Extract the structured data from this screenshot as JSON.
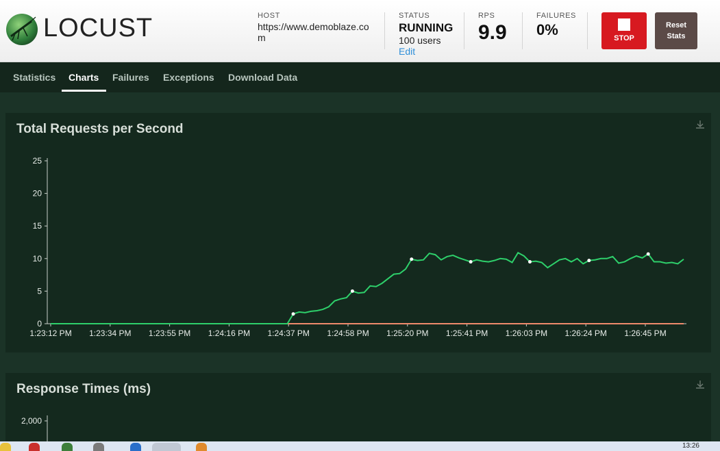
{
  "app": {
    "name": "LOCUST"
  },
  "header": {
    "host_label": "HOST",
    "host_value": "https://www.demoblaze.com",
    "status_label": "STATUS",
    "status_value": "RUNNING",
    "users_value": "100 users",
    "edit_label": "Edit",
    "rps_label": "RPS",
    "rps_value": "9.9",
    "failures_label": "FAILURES",
    "failures_value": "0%",
    "stop_label": "STOP",
    "reset_label_1": "Reset",
    "reset_label_2": "Stats"
  },
  "tabs": [
    {
      "label": "Statistics"
    },
    {
      "label": "Charts"
    },
    {
      "label": "Failures"
    },
    {
      "label": "Exceptions"
    },
    {
      "label": "Download Data"
    }
  ],
  "active_tab": "Charts",
  "panels": {
    "rps_title": "Total Requests per Second",
    "response_title": "Response Times (ms)",
    "response_first_tick": "2,000"
  },
  "colors": {
    "rps_line": "#2ed06b",
    "failures_line": "#ef8a6c",
    "stop": "#d71920",
    "reset": "#5b4a47"
  },
  "taskbar": {
    "clock": "13:26"
  },
  "chart_data": {
    "type": "line",
    "title": "Total Requests per Second",
    "x_tick_labels": [
      "1:23:12 PM",
      "1:23:34 PM",
      "1:23:55 PM",
      "1:24:16 PM",
      "1:24:37 PM",
      "1:24:58 PM",
      "1:25:20 PM",
      "1:25:41 PM",
      "1:26:03 PM",
      "1:26:24 PM",
      "1:26:45 PM"
    ],
    "y_ticks": [
      0,
      5,
      10,
      15,
      20,
      25
    ],
    "ylim": [
      0,
      25
    ],
    "x": [
      "1:23:12 PM",
      "1:23:14 PM",
      "1:23:16 PM",
      "1:23:18 PM",
      "1:23:20 PM",
      "1:23:22 PM",
      "1:23:24 PM",
      "1:23:26 PM",
      "1:23:28 PM",
      "1:23:30 PM",
      "1:23:32 PM",
      "1:23:34 PM",
      "1:23:36 PM",
      "1:23:38 PM",
      "1:23:40 PM",
      "1:23:42 PM",
      "1:23:44 PM",
      "1:23:46 PM",
      "1:23:48 PM",
      "1:23:50 PM",
      "1:23:52 PM",
      "1:23:55 PM",
      "1:23:57 PM",
      "1:23:59 PM",
      "1:24:01 PM",
      "1:24:03 PM",
      "1:24:05 PM",
      "1:24:07 PM",
      "1:24:09 PM",
      "1:24:11 PM",
      "1:24:13 PM",
      "1:24:16 PM",
      "1:24:18 PM",
      "1:24:20 PM",
      "1:24:22 PM",
      "1:24:24 PM",
      "1:24:26 PM",
      "1:24:28 PM",
      "1:24:30 PM",
      "1:24:32 PM",
      "1:24:34 PM",
      "1:24:37 PM",
      "1:24:39 PM",
      "1:24:41 PM",
      "1:24:43 PM",
      "1:24:45 PM",
      "1:24:47 PM",
      "1:24:49 PM",
      "1:24:51 PM",
      "1:24:53 PM",
      "1:24:55 PM",
      "1:24:58 PM",
      "1:25:00 PM",
      "1:25:02 PM",
      "1:25:04 PM",
      "1:25:06 PM",
      "1:25:08 PM",
      "1:25:10 PM",
      "1:25:12 PM",
      "1:25:14 PM",
      "1:25:16 PM",
      "1:25:20 PM",
      "1:25:22 PM",
      "1:25:24 PM",
      "1:25:26 PM",
      "1:25:28 PM",
      "1:25:30 PM",
      "1:25:32 PM",
      "1:25:34 PM",
      "1:25:36 PM",
      "1:25:38 PM",
      "1:25:41 PM",
      "1:25:43 PM",
      "1:25:45 PM",
      "1:25:47 PM",
      "1:25:49 PM",
      "1:25:51 PM",
      "1:25:53 PM",
      "1:25:55 PM",
      "1:25:57 PM",
      "1:25:59 PM",
      "1:26:03 PM",
      "1:26:05 PM",
      "1:26:07 PM",
      "1:26:09 PM",
      "1:26:11 PM",
      "1:26:13 PM",
      "1:26:15 PM",
      "1:26:17 PM",
      "1:26:19 PM",
      "1:26:21 PM",
      "1:26:24 PM",
      "1:26:26 PM",
      "1:26:28 PM",
      "1:26:30 PM",
      "1:26:32 PM",
      "1:26:34 PM",
      "1:26:36 PM",
      "1:26:38 PM",
      "1:26:40 PM",
      "1:26:42 PM",
      "1:26:45 PM",
      "1:26:47 PM",
      "1:26:49 PM",
      "1:26:51 PM",
      "1:26:53 PM",
      "1:26:55 PM",
      "1:26:57 PM"
    ],
    "series": [
      {
        "values": [
          0,
          0,
          0,
          0,
          0,
          0,
          0,
          0,
          0,
          0,
          0,
          0,
          0,
          0,
          0,
          0,
          0,
          0,
          0,
          0,
          0,
          0,
          0,
          0,
          0,
          0,
          0,
          0,
          0,
          0,
          0,
          0,
          0,
          0,
          0,
          0,
          0,
          0,
          0,
          0,
          0,
          1.5,
          1.8,
          1.7,
          1.9,
          2.0,
          2.2,
          2.6,
          3.5,
          3.8,
          4.0,
          5.0,
          4.7,
          4.8,
          5.8,
          5.7,
          6.2,
          6.9,
          7.6,
          7.7,
          8.4,
          9.9,
          9.7,
          9.8,
          10.8,
          10.6,
          9.8,
          10.3,
          10.5,
          10.1,
          9.8,
          9.5,
          9.8,
          9.6,
          9.5,
          9.7,
          10.0,
          9.9,
          9.4,
          10.9,
          10.4,
          9.5,
          9.6,
          9.4,
          8.6,
          9.2,
          9.8,
          10.0,
          9.5,
          10.0,
          9.2,
          9.7,
          9.8,
          10.0,
          10.0,
          10.3,
          9.3,
          9.5,
          10.0,
          10.4,
          10.1,
          10.7,
          9.5,
          9.5,
          9.3,
          9.4,
          9.2,
          9.9
        ]
      },
      {
        "values": [
          0,
          0,
          0,
          0,
          0,
          0,
          0,
          0,
          0,
          0,
          0,
          0,
          0,
          0,
          0,
          0,
          0,
          0,
          0,
          0,
          0,
          0,
          0,
          0,
          0,
          0,
          0,
          0,
          0,
          0,
          0,
          0,
          0,
          0,
          0,
          0,
          0,
          0,
          0,
          0,
          0,
          0,
          0,
          0,
          0,
          0,
          0,
          0,
          0,
          0,
          0,
          0,
          0,
          0,
          0,
          0,
          0,
          0,
          0,
          0,
          0,
          0,
          0,
          0,
          0,
          0,
          0,
          0,
          0,
          0,
          0,
          0,
          0,
          0,
          0,
          0,
          0,
          0,
          0,
          0,
          0,
          0,
          0,
          0,
          0,
          0,
          0,
          0,
          0,
          0,
          0,
          0,
          0,
          0,
          0,
          0,
          0,
          0,
          0,
          0,
          0,
          0,
          0,
          0,
          0,
          0,
          0,
          0
        ]
      }
    ],
    "markers_at_indices": [
      41,
      51,
      61,
      71,
      81,
      91,
      101
    ],
    "grid": false
  }
}
